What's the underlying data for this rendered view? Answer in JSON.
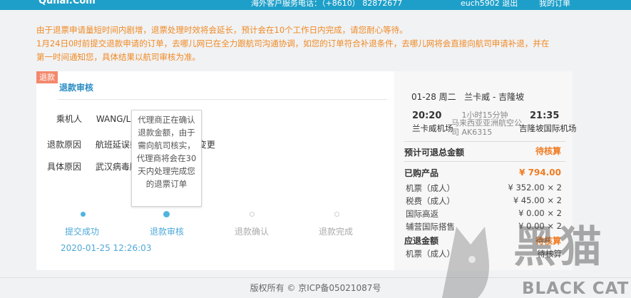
{
  "topbar": {
    "logo": "Qunar.Com",
    "phone": "海外客户服务电话：（+8610） 82872677",
    "user": "euch5902  退出",
    "my_orders": "我的订单"
  },
  "notice": [
    "由于退票申请量短时间内剧增，退票处理时效将会延长，预计会在10个工作日内完成，请您耐心等待。",
    "1月24日0时前提交退款申请的订单，去哪儿网已在全力跟航司沟通协调，如您的订单符合补退条件，去哪儿网将会直接向航司申请补退，并在",
    "第一时间通知您，具体结果以航司审核为准。"
  ],
  "refund_tag": "退款",
  "panel_title": "退款审核",
  "info": {
    "passenger_label": "乘机人",
    "passenger_value": "WANG/LIN...YI...",
    "reason_label": "退款原因",
    "reason_value": "航班延误或取消、航班时刻变更",
    "detail_label": "具体原因",
    "detail_value": "武汉病毒肺炎"
  },
  "tooltip": "代理商正在确认退款金额，由于需向航司核实，代理商将会在30天内处理完成您的退票订单",
  "steps": [
    {
      "label": "提交成功",
      "state": "done"
    },
    {
      "label": "退款审核",
      "state": "current"
    },
    {
      "label": "退款确认",
      "state": "todo"
    },
    {
      "label": "退款完成",
      "state": "todo"
    }
  ],
  "submit_time": "2020-01-25 12:26:03",
  "flight": {
    "date": "01-28 周二",
    "route": "兰卡威 - 吉隆坡",
    "dep_time": "20:20",
    "arr_time": "21:35",
    "duration": "1小时15分钟",
    "carrier": "马来西亚亚洲航空公司 AK6315",
    "dep_airport": "兰卡威机场",
    "arr_airport": "吉隆坡国际机场"
  },
  "summary": {
    "expected_label": "预计可退总金额",
    "expected_value": "待核算",
    "purchased_label": "已购产品",
    "purchased_value": "¥ 794.00",
    "items": [
      {
        "label": "机票（成人）",
        "value": "¥ 352.00 × 2"
      },
      {
        "label": "税费（成人）",
        "value": "¥ 45.00 × 2"
      },
      {
        "label": "国际高返",
        "value": "¥ 0.00 × 2"
      },
      {
        "label": "辅营国际搭售",
        "value": "¥ 0.00 × 2"
      }
    ],
    "refund_label": "应退金额",
    "refund_value": "待核算",
    "refund_items": [
      {
        "label": "机票（成人）",
        "value": "待核算"
      }
    ]
  },
  "footer": "版权所有 © 京ICP备05021087号",
  "watermark": {
    "han": "黑猫",
    "en": "BLACK CAT"
  },
  "colors": {
    "accent": "#2a8cc3",
    "orange": "#f07c22",
    "notice": "#f08a24",
    "tag": "#f4886c"
  }
}
